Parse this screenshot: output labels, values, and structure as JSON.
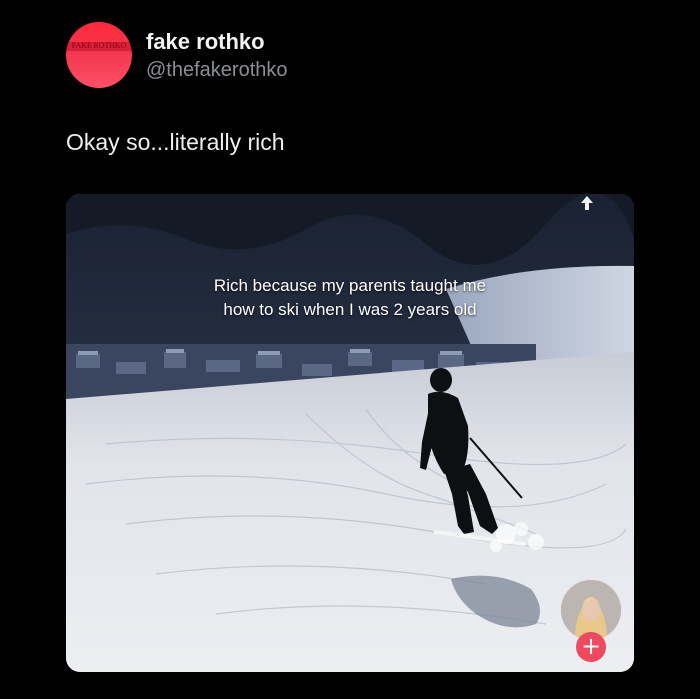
{
  "tweet": {
    "author": {
      "display_name": "fake rothko",
      "handle": "@thefakerothko",
      "avatar_text": "FAKE ROTHKO"
    },
    "text": "Okay so...literally rich"
  },
  "media": {
    "caption": "Rich because my parents taught me how to ski when I was 2 years old",
    "icons": [
      "share-icon"
    ],
    "creator_follow_symbol": "+"
  },
  "colors": {
    "background": "#000000",
    "avatar_red": "#f2364d",
    "handle_gray": "#8b8f94",
    "follow_pink": "#f0485e"
  }
}
